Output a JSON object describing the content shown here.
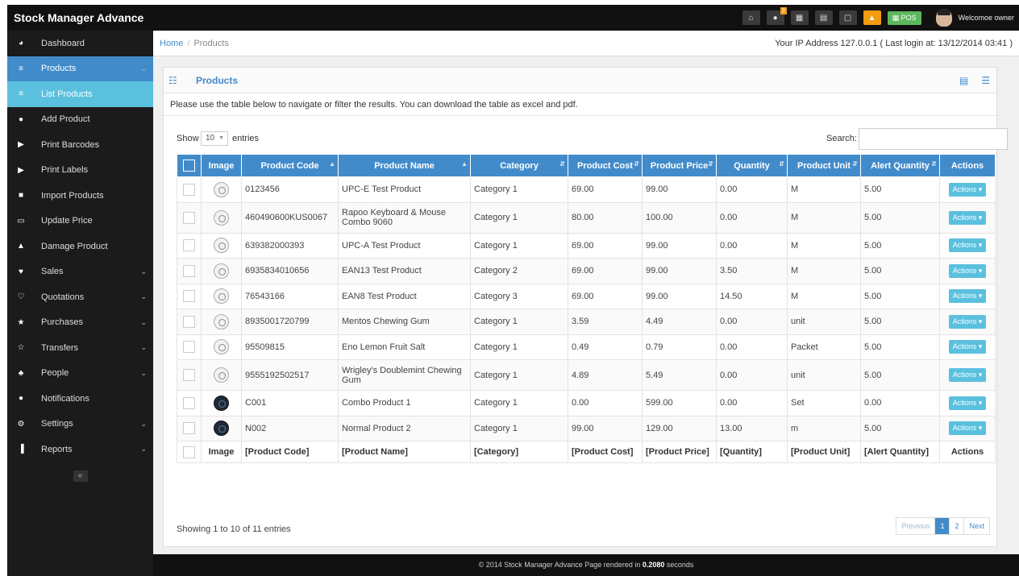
{
  "app": {
    "brand": "Stock Manager Advance"
  },
  "topbar": {
    "icons": [
      "home-icon",
      "info-icon",
      "calendar-icon",
      "calculator-icon",
      "cart-icon",
      "warning-icon"
    ],
    "info_badge": "3",
    "pos_label": "POS",
    "welcome": "Welcomoe owner"
  },
  "sidebar": {
    "items": [
      {
        "label": "Dashboard",
        "icon": "dashboard-icon",
        "glyph": "◕"
      },
      {
        "label": "Products",
        "icon": "barcode-icon",
        "glyph": "≡",
        "expandable": true
      },
      {
        "label": "List Products",
        "icon": "barcode-icon",
        "glyph": "≡"
      },
      {
        "label": "Add Product",
        "icon": "plus-circle-icon",
        "glyph": "●"
      },
      {
        "label": "Print Barcodes",
        "icon": "tags-icon",
        "glyph": "▶"
      },
      {
        "label": "Print Labels",
        "icon": "tags-icon",
        "glyph": "▶"
      },
      {
        "label": "Import Products",
        "icon": "file-icon",
        "glyph": "■"
      },
      {
        "label": "Update Price",
        "icon": "money-icon",
        "glyph": "▭"
      },
      {
        "label": "Damage Product",
        "icon": "filter-icon",
        "glyph": "▲"
      },
      {
        "label": "Sales",
        "icon": "heart-icon",
        "glyph": "♥",
        "expandable": true
      },
      {
        "label": "Quotations",
        "icon": "heart-outline-icon",
        "glyph": "♡",
        "expandable": true
      },
      {
        "label": "Purchases",
        "icon": "star-icon",
        "glyph": "★",
        "expandable": true
      },
      {
        "label": "Transfers",
        "icon": "star-outline-icon",
        "glyph": "☆",
        "expandable": true
      },
      {
        "label": "People",
        "icon": "users-icon",
        "glyph": "♣",
        "expandable": true
      },
      {
        "label": "Notifications",
        "icon": "info-circle-icon",
        "glyph": "●"
      },
      {
        "label": "Settings",
        "icon": "cog-icon",
        "glyph": "⚙",
        "expandable": true
      },
      {
        "label": "Reports",
        "icon": "bar-chart-icon",
        "glyph": "▐",
        "expandable": true
      }
    ],
    "collapse_label": "«"
  },
  "breadcrumb": {
    "home": "Home",
    "separator": "/",
    "current": "Products"
  },
  "ip_info": "Your IP Address 127.0.0.1 ( Last login at: 13/12/2014 03:41 )",
  "panel": {
    "title": "Products",
    "intro": "Please use the table below to navigate or filter the results. You can download the table as excel and pdf."
  },
  "controls": {
    "show": "Show",
    "length": "10",
    "entries": "entries",
    "search_label": "Search:",
    "search_value": ""
  },
  "table": {
    "headers": [
      "Image",
      "Product Code",
      "Product Name",
      "Category",
      "Product Cost",
      "Product Price",
      "Quantity",
      "Product Unit",
      "Alert Quantity",
      "Actions"
    ],
    "rows": [
      {
        "code": "0123456",
        "name": "UPC-E Test Product",
        "category": "Category 1",
        "cost": "69.00",
        "price": "99.00",
        "qty": "0.00",
        "unit": "M",
        "alert": "5.00",
        "action": "Actions",
        "img": "light",
        "tall": false
      },
      {
        "code": "460490600KUS0067",
        "name": "Rapoo Keyboard & Mouse Combo 9060",
        "category": "Category 1",
        "cost": "80.00",
        "price": "100.00",
        "qty": "0.00",
        "unit": "M",
        "alert": "5.00",
        "action": "Actions",
        "img": "light",
        "tall": true
      },
      {
        "code": "639382000393",
        "name": "UPC-A Test Product",
        "category": "Category 1",
        "cost": "69.00",
        "price": "99.00",
        "qty": "0.00",
        "unit": "M",
        "alert": "5.00",
        "action": "Actions",
        "img": "light",
        "tall": false
      },
      {
        "code": "6935834010656",
        "name": "EAN13 Test Product",
        "category": "Category 2",
        "cost": "69.00",
        "price": "99.00",
        "qty": "3.50",
        "unit": "M",
        "alert": "5.00",
        "action": "Actions",
        "img": "light",
        "tall": false
      },
      {
        "code": "76543166",
        "name": "EAN8 Test Product",
        "category": "Category 3",
        "cost": "69.00",
        "price": "99.00",
        "qty": "14.50",
        "unit": "M",
        "alert": "5.00",
        "action": "Actions",
        "img": "light",
        "tall": false
      },
      {
        "code": "8935001720799",
        "name": "Mentos Chewing Gum",
        "category": "Category 1",
        "cost": "3.59",
        "price": "4.49",
        "qty": "0.00",
        "unit": "unit",
        "alert": "5.00",
        "action": "Actions",
        "img": "light",
        "tall": false
      },
      {
        "code": "95509815",
        "name": "Eno Lemon Fruit Salt",
        "category": "Category 1",
        "cost": "0.49",
        "price": "0.79",
        "qty": "0.00",
        "unit": "Packet",
        "alert": "5.00",
        "action": "Actions",
        "img": "light",
        "tall": false
      },
      {
        "code": "9555192502517",
        "name": "Wrigley's Doublemint Chewing Gum",
        "category": "Category 1",
        "cost": "4.89",
        "price": "5.49",
        "qty": "0.00",
        "unit": "unit",
        "alert": "5.00",
        "action": "Actions",
        "img": "light",
        "tall": true
      },
      {
        "code": "C001",
        "name": "Combo Product 1",
        "category": "Category 1",
        "cost": "0.00",
        "price": "599.00",
        "qty": "0.00",
        "unit": "Set",
        "alert": "0.00",
        "action": "Actions",
        "img": "dark",
        "tall": false
      },
      {
        "code": "N002",
        "name": "Normal Product 2",
        "category": "Category 1",
        "cost": "99.00",
        "price": "129.00",
        "qty": "13.00",
        "unit": "m",
        "alert": "5.00",
        "action": "Actions",
        "img": "dark",
        "tall": false
      }
    ],
    "footer": [
      "Image",
      "[Product Code]",
      "[Product Name]",
      "[Category]",
      "[Product Cost]",
      "[Product Price]",
      "[Quantity]",
      "[Product Unit]",
      "[Alert Quantity]",
      "Actions"
    ]
  },
  "pagination": {
    "info": "Showing 1 to 10 of 11 entries",
    "previous": "Previous",
    "pages": [
      "1",
      "2"
    ],
    "current": "1",
    "next": "Next"
  },
  "footer": {
    "prefix": "© 2014 Stock Manager Advance Page rendered in ",
    "time": "0.2080",
    "suffix": " seconds"
  },
  "colors": {
    "primary": "#428bca",
    "info": "#5bc0de",
    "dark": "#111111",
    "success": "#5cb85c",
    "warning": "#f39c12"
  }
}
